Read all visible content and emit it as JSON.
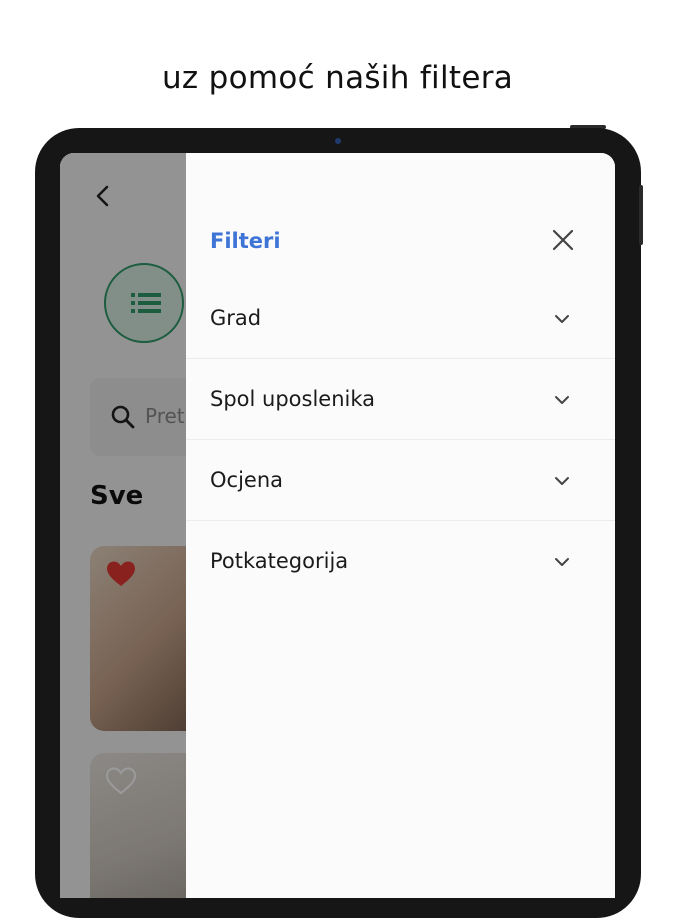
{
  "headline": "uz pomoć naših filtera",
  "background_app": {
    "search_placeholder": "Pretr",
    "section_title": "Sve"
  },
  "drawer": {
    "title": "Filteri",
    "filters": [
      {
        "label": "Grad"
      },
      {
        "label": "Spol uposlenika"
      },
      {
        "label": "Ocjena"
      },
      {
        "label": "Potkategorija"
      }
    ]
  },
  "colors": {
    "accent": "#3d74d6",
    "category_green": "#2f9a6a",
    "heart_red": "#e53935"
  },
  "icons": [
    "chevron-left-icon",
    "list-icon",
    "search-icon",
    "heart-filled-icon",
    "heart-outline-icon",
    "close-icon",
    "chevron-down-icon"
  ]
}
